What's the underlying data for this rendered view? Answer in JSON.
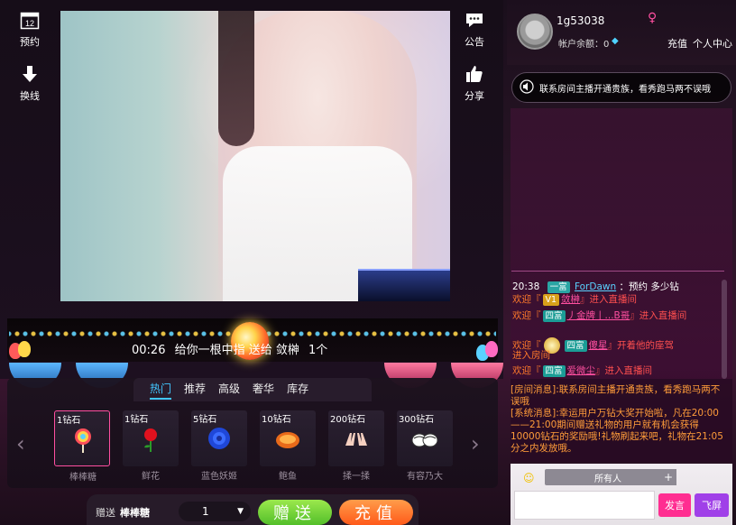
{
  "left_tools": [
    {
      "icon": "calendar-icon",
      "label": "预约",
      "badge": "12"
    },
    {
      "icon": "down-arrow-icon",
      "label": "换线"
    }
  ],
  "right_tools": [
    {
      "icon": "chat-bubble-icon",
      "label": "公告"
    },
    {
      "icon": "thumbs-up-icon",
      "label": "分享"
    }
  ],
  "ticker": {
    "time": "00:26",
    "text": "给你一根中指 送给 敛榊",
    "count": "1个"
  },
  "gift_tabs": [
    {
      "label": "热门",
      "active": true
    },
    {
      "label": "推荐",
      "active": false
    },
    {
      "label": "高级",
      "active": false
    },
    {
      "label": "奢华",
      "active": false
    },
    {
      "label": "库存",
      "active": false
    }
  ],
  "gifts": [
    {
      "price": "1钻石",
      "name": "棒棒糖",
      "icon": "lollipop-icon",
      "selected": true
    },
    {
      "price": "1钻石",
      "name": "鲜花",
      "icon": "rose-icon",
      "selected": false
    },
    {
      "price": "5钻石",
      "name": "蓝色妖姬",
      "icon": "blue-rose-icon",
      "selected": false
    },
    {
      "price": "10钻石",
      "name": "鲍鱼",
      "icon": "abalone-icon",
      "selected": false
    },
    {
      "price": "200钻石",
      "name": "揉一揉",
      "icon": "hands-icon",
      "selected": false
    },
    {
      "price": "300钻石",
      "name": "有容乃大",
      "icon": "lingerie-icon",
      "selected": false
    }
  ],
  "send_bar": {
    "label": "赠送",
    "selected_gift": "棒棒糖",
    "quantity": "1",
    "send_label": "赠送",
    "recharge_label": "充值"
  },
  "user": {
    "name": "1g53038",
    "balance_label": "帐户余额：0",
    "recharge_link": "充值",
    "center_link": "个人中心"
  },
  "announcement": "联系房间主播开通贵族，看秀跑马两不误哦",
  "chat": [
    {
      "time": "20:38",
      "tag": "一富",
      "user": "ForDawn",
      "text": "：预约  多少钻"
    },
    {
      "prefix": "欢迎『",
      "tag": "V1",
      "user": "敛榊",
      "suffix": "』进入直播间"
    },
    {
      "prefix": "欢迎『",
      "tag": "四富",
      "user": "丿金牌丨...B哥",
      "suffix": "』进入直播间"
    },
    {
      "prefix": "欢迎『",
      "tag": "四富",
      "user": "傻星",
      "suffix": "』开着他的座驾",
      "line2": "进入房间"
    },
    {
      "prefix": "欢迎『",
      "tag": "四富",
      "user": "爱微尘",
      "suffix": "』进入直播间"
    }
  ],
  "system": {
    "line1": "[房间消息]:联系房间主播开通贵族，看秀跑马两不误哦",
    "line2": "[系统消息]:幸运用户万钻大奖开始啦，凡在20:00——21:00期间赠送礼物的用户就有机会获得10000钻石的奖励哦!礼物刷起来吧，礼物在21:05分之内发放哦。"
  },
  "chat_input": {
    "recipient": "所有人",
    "speak_label": "发言",
    "bullet_label": "飞屏"
  },
  "colors": {
    "accent_blue": "#42c7ff",
    "pink": "#ff2e91",
    "purple": "#a040e8",
    "green": "#53bf2a",
    "orange": "#ff5a1a"
  }
}
